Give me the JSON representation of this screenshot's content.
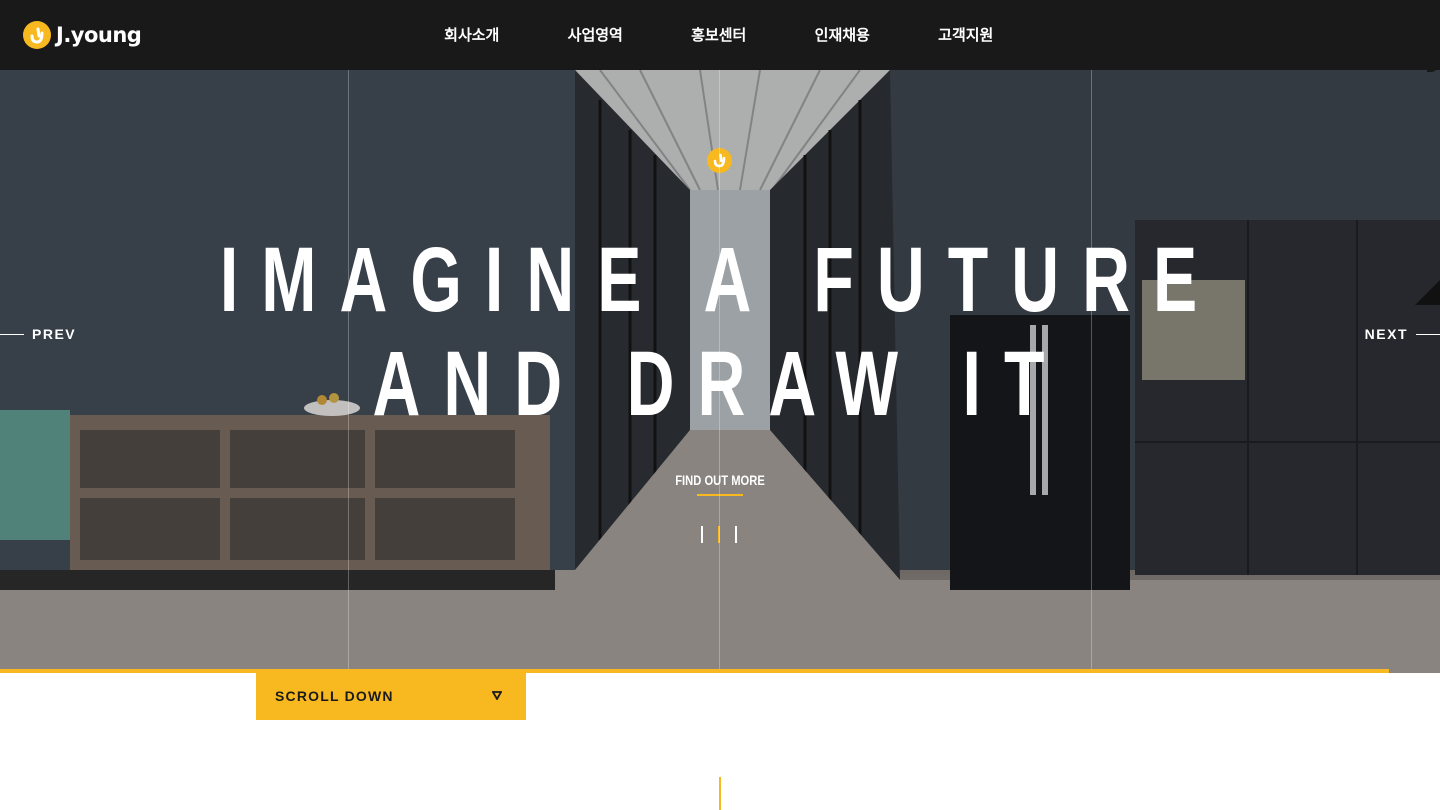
{
  "header": {
    "logo_text": "J.young",
    "nav": [
      {
        "label": "회사소개"
      },
      {
        "label": "사업영역"
      },
      {
        "label": "홍보센터"
      },
      {
        "label": "인재채용"
      },
      {
        "label": "고객지원"
      }
    ]
  },
  "hero": {
    "headline_line1": "IMAGINE A FUTURE",
    "headline_line2": "AND DRAW IT",
    "cta_label": "FIND OUT MORE",
    "prev_label": "PREV",
    "next_label": "NEXT",
    "slides_total": 3,
    "active_slide": 2
  },
  "scroll": {
    "label": "SCROLL DOWN"
  },
  "colors": {
    "accent": "#f7b91f",
    "header_bg": "#191919"
  },
  "icons": [
    "logo-mark-icon",
    "chevron-down-icon"
  ]
}
